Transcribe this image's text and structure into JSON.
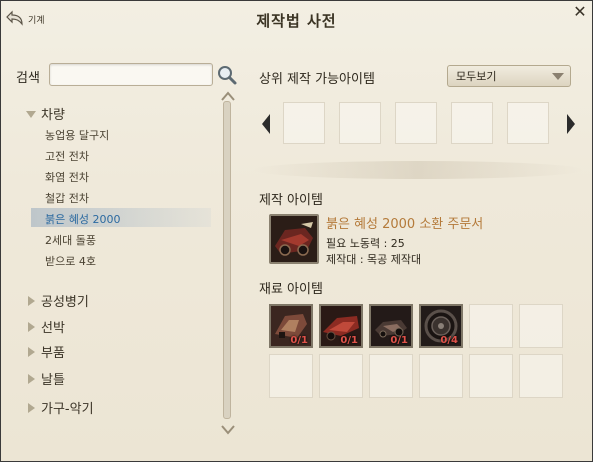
{
  "window": {
    "title": "제작법 사전",
    "back_label": "기계",
    "close_label": "✕"
  },
  "search": {
    "label": "검색",
    "value": "",
    "placeholder": ""
  },
  "tree": {
    "categories": [
      {
        "label": "차량",
        "expanded": true
      },
      {
        "label": "공성병기",
        "expanded": false
      },
      {
        "label": "선박",
        "expanded": false
      },
      {
        "label": "부품",
        "expanded": false
      },
      {
        "label": "날틀",
        "expanded": false
      },
      {
        "label": "가구-악기",
        "expanded": false
      }
    ],
    "vehicle_items": [
      {
        "label": "농업용 달구지"
      },
      {
        "label": "고전 전차"
      },
      {
        "label": "화염 전차"
      },
      {
        "label": "철갑 전차"
      },
      {
        "label": "붉은 혜성 2000",
        "selected": true
      },
      {
        "label": "2세대 돌풍"
      },
      {
        "label": "받으로 4호"
      }
    ]
  },
  "upper": {
    "title": "상위 제작 가능아이템",
    "filter": {
      "selected": "모두보기"
    }
  },
  "craft": {
    "title": "제작 아이템",
    "item_name": "붉은 혜성 2000 소환 주문서",
    "labor": "필요 노동력 : 25",
    "bench": "제작대 : 목공 제작대"
  },
  "materials": {
    "title": "재료 아이템",
    "items": [
      {
        "count": "0/1",
        "icon": "vehicle-part-icon"
      },
      {
        "count": "0/1",
        "icon": "vehicle-frame-icon"
      },
      {
        "count": "0/1",
        "icon": "engine-part-icon"
      },
      {
        "count": "0/4",
        "icon": "wheel-icon"
      }
    ]
  },
  "colors": {
    "accent_text": "#b47a3a",
    "selected_text": "#2c6aa0",
    "count_text": "#e0524a"
  }
}
